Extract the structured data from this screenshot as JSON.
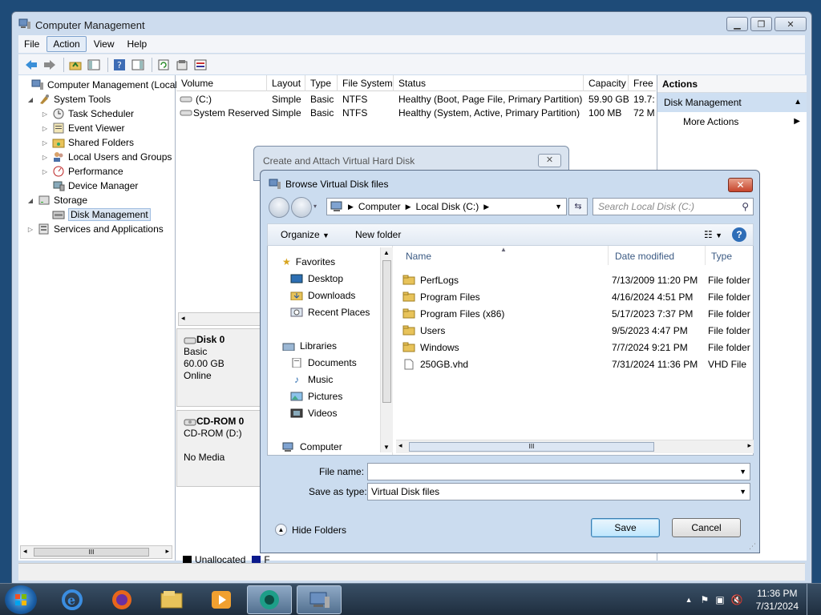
{
  "main_window": {
    "title": "Computer Management",
    "menu": [
      "File",
      "Action",
      "View",
      "Help"
    ],
    "active_menu": "Action",
    "tree": {
      "root": "Computer Management (Local",
      "system_tools": "System Tools",
      "task_scheduler": "Task Scheduler",
      "event_viewer": "Event Viewer",
      "shared_folders": "Shared Folders",
      "local_users": "Local Users and Groups",
      "performance": "Performance",
      "device_manager": "Device Manager",
      "storage": "Storage",
      "disk_management": "Disk Management",
      "services": "Services and Applications",
      "scroll_glyph": "III"
    },
    "volumes": {
      "headers": [
        "Volume",
        "Layout",
        "Type",
        "File System",
        "Status",
        "Capacity",
        "Free"
      ],
      "rows": [
        [
          "(C:)",
          "Simple",
          "Basic",
          "NTFS",
          "Healthy (Boot, Page File, Primary Partition)",
          "59.90 GB",
          "19.7:"
        ],
        [
          "System Reserved",
          "Simple",
          "Basic",
          "NTFS",
          "Healthy (System, Active, Primary Partition)",
          "100 MB",
          "72 M"
        ]
      ]
    },
    "disks": {
      "disk0": {
        "name": "Disk 0",
        "type": "Basic",
        "size": "60.00 GB",
        "status": "Online"
      },
      "cdrom": {
        "name": "CD-ROM 0",
        "drive": "CD-ROM (D:)",
        "status": "No Media"
      }
    },
    "legend": {
      "unallocated": "Unallocated",
      "primary_partial": "F"
    },
    "actions": {
      "header": "Actions",
      "section": "Disk Management",
      "more": "More Actions"
    }
  },
  "back_dialog": {
    "title": "Create and Attach Virtual Hard Disk"
  },
  "dialog": {
    "title": "Browse Virtual Disk files",
    "address": [
      "Computer",
      "Local Disk (C:)"
    ],
    "search_placeholder": "Search Local Disk (C:)",
    "organize": "Organize",
    "new_folder": "New folder",
    "nav": {
      "favorites": "Favorites",
      "desktop": "Desktop",
      "downloads": "Downloads",
      "recent": "Recent Places",
      "libraries": "Libraries",
      "documents": "Documents",
      "music": "Music",
      "pictures": "Pictures",
      "videos": "Videos",
      "computer": "Computer"
    },
    "columns": {
      "name": "Name",
      "date": "Date modified",
      "type": "Type"
    },
    "files": [
      {
        "name": "PerfLogs",
        "date": "7/13/2009 11:20 PM",
        "type": "File folder",
        "kind": "folder"
      },
      {
        "name": "Program Files",
        "date": "4/16/2024 4:51 PM",
        "type": "File folder",
        "kind": "folder"
      },
      {
        "name": "Program Files (x86)",
        "date": "5/17/2023 7:37 PM",
        "type": "File folder",
        "kind": "folder"
      },
      {
        "name": "Users",
        "date": "9/5/2023 4:47 PM",
        "type": "File folder",
        "kind": "folder"
      },
      {
        "name": "Windows",
        "date": "7/7/2024 9:21 PM",
        "type": "File folder",
        "kind": "folder"
      },
      {
        "name": "250GB.vhd",
        "date": "7/31/2024 11:36 PM",
        "type": "VHD File",
        "kind": "file"
      }
    ],
    "scroll_glyph": "III",
    "file_name_label": "File name:",
    "file_name_value": "",
    "save_type_label": "Save as type:",
    "save_type_value": "Virtual Disk files",
    "hide_folders": "Hide Folders",
    "save": "Save",
    "cancel": "Cancel"
  },
  "taskbar": {
    "time": "11:36 PM",
    "date": "7/31/2024"
  }
}
